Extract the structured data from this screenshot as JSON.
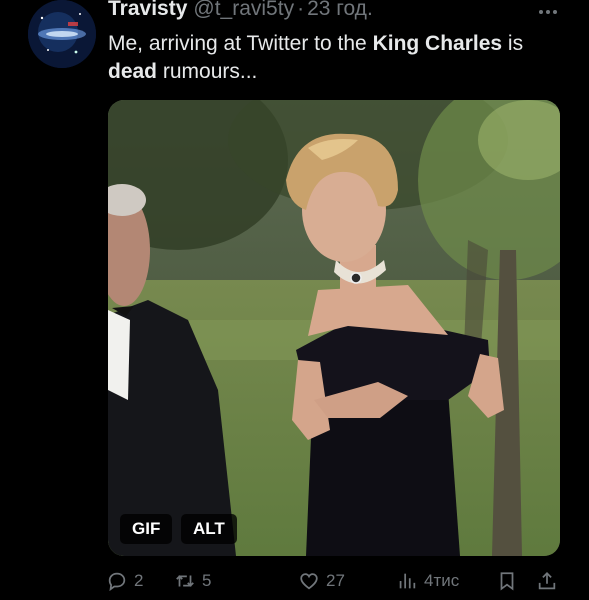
{
  "tweet": {
    "display_name": "Travisty",
    "handle": "@t_ravi5ty",
    "separator": "·",
    "time": "23 год.",
    "text": {
      "part1": "Me, arriving at Twitter to the ",
      "bold1": "King Charles",
      "part2": " is ",
      "bold2": "dead",
      "part3": " rumours..."
    },
    "media": {
      "gif_badge": "GIF",
      "alt_badge": "ALT"
    },
    "actions": {
      "replies": "2",
      "retweets": "5",
      "likes": "27",
      "views": "4тис"
    }
  },
  "icons": {
    "more": "more-horizontal-icon",
    "reply": "reply-icon",
    "retweet": "retweet-icon",
    "like": "heart-icon",
    "views": "views-chart-icon",
    "bookmark": "bookmark-icon",
    "share": "share-icon"
  },
  "colors": {
    "background": "#000000",
    "text": "#e7e9ea",
    "muted": "#71767b"
  }
}
